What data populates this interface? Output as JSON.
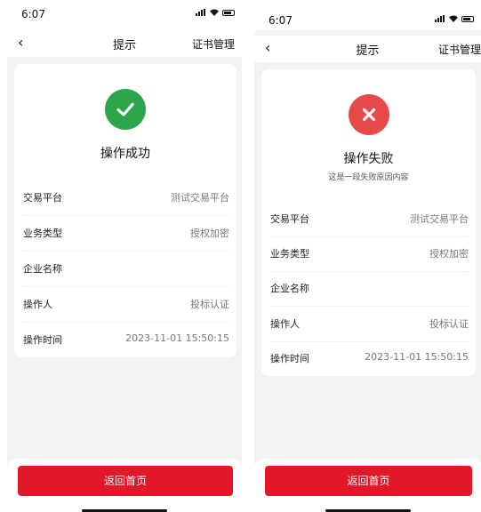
{
  "screens": [
    {
      "status_time": "6:07",
      "title": "提示",
      "nav_right": "证书管理",
      "result_title": "操作成功",
      "result_subtitle": "",
      "status": "success",
      "status_color": "#2da54a",
      "fields": [
        {
          "label": "交易平台",
          "value": "测试交易平台"
        },
        {
          "label": "业务类型",
          "value": "授权加密"
        },
        {
          "label": "企业名称",
          "value": ""
        },
        {
          "label": "操作人",
          "value": "投标认证"
        },
        {
          "label": "操作时间",
          "value": "2023-11-01 15:50:15"
        }
      ],
      "button_label": "返回首页"
    },
    {
      "status_time": "6:07",
      "title": "提示",
      "nav_right": "证书管理",
      "result_title": "操作失败",
      "result_subtitle": "这是一段失败原因内容",
      "status": "failure",
      "status_color": "#e84a4a",
      "fields": [
        {
          "label": "交易平台",
          "value": "测试交易平台"
        },
        {
          "label": "业务类型",
          "value": "授权加密"
        },
        {
          "label": "企业名称",
          "value": ""
        },
        {
          "label": "操作人",
          "value": "投标认证"
        },
        {
          "label": "操作时间",
          "value": "2023-11-01 15:50:15"
        }
      ],
      "button_label": "返回首页"
    }
  ],
  "accent_color": "#e0182a"
}
